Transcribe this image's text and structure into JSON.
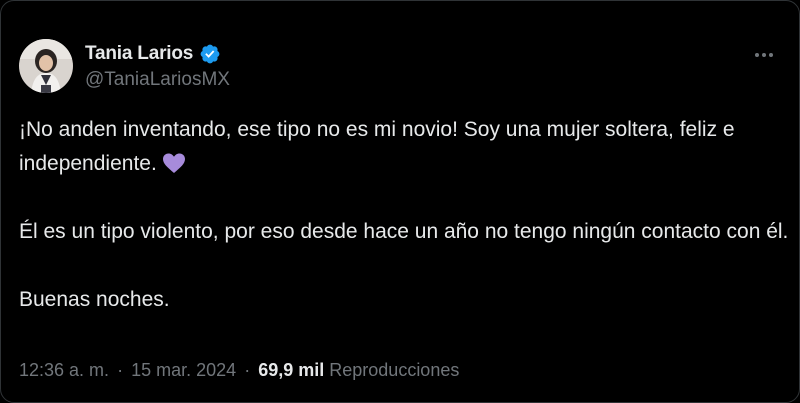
{
  "user": {
    "display_name": "Tania Larios",
    "handle": "@TaniaLariosMX",
    "verified_icon": "verified-badge-icon",
    "avatar": "profile-avatar"
  },
  "tweet": {
    "line1_part": "¡No anden inventando, ese tipo no es mi novio! Soy una mujer soltera, feliz e independiente.",
    "emoji": "purple-heart",
    "paragraph2": "Él es un tipo violento, por eso desde hace un año no tengo ningún contacto con él.",
    "paragraph3": "Buenas noches."
  },
  "meta": {
    "time": "12:36 a. m.",
    "separator": "·",
    "date": "15 mar. 2024",
    "views_count": "69,9 mil",
    "views_label": "Reproducciones"
  },
  "colors": {
    "background": "#000000",
    "text_primary": "#e7e9ea",
    "text_secondary": "#71767b",
    "verified_blue": "#1d9bf0",
    "heart_purple": "#a78bdb"
  },
  "icons": {
    "more": "more-options-icon"
  }
}
